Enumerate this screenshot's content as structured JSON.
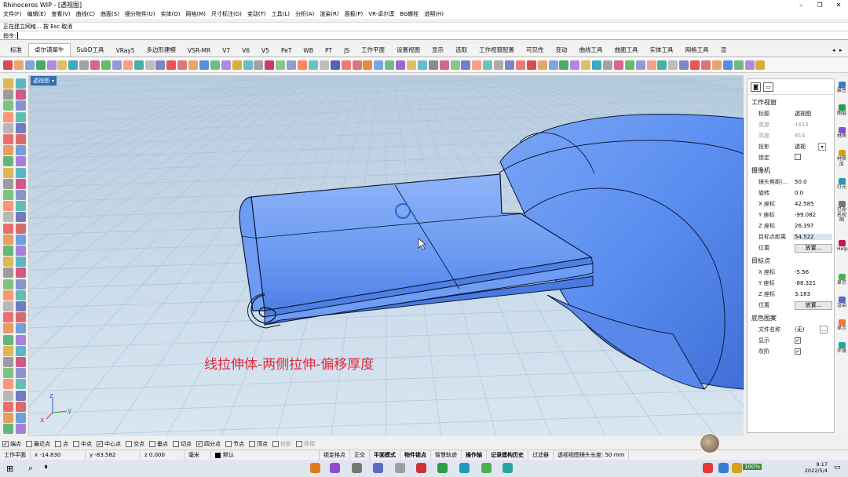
{
  "window": {
    "title": "Rhinoceros WIP - [透视图]",
    "controls": [
      "–",
      "❐",
      "✕"
    ]
  },
  "menu": [
    "文件(F)",
    "编辑(E)",
    "查看(V)",
    "曲线(C)",
    "曲面(S)",
    "细分物件(U)",
    "实体(O)",
    "网格(M)",
    "尺寸标注(D)",
    "变动(T)",
    "工具(L)",
    "分析(A)",
    "渲染(R)",
    "面板(P)",
    "VR-卓尔谟",
    "BG螺栓",
    "说明(H)"
  ],
  "command": {
    "history": "正在建立网格... 按 Esc 取消",
    "prompt": "指令:"
  },
  "tabs": [
    "标准",
    "卓尔谟犀牛",
    "SubD工具",
    "VRay5",
    "多边形建模",
    "VSR-MR",
    "V7",
    "V6",
    "V5",
    "PeT",
    "WB",
    "PT",
    "JS",
    "工作平面",
    "设置视图",
    "显示",
    "选取",
    "工作视窗配置",
    "可见性",
    "变动",
    "曲线工具",
    "曲面工具",
    "实体工具",
    "网格工具",
    "渲"
  ],
  "active_tab_index": 1,
  "viewport": {
    "label": "透视图",
    "caption": "线拉伸体-两侧拉伸-偏移厚度",
    "axes": {
      "x": "x",
      "y": "y",
      "z": "z"
    }
  },
  "properties": {
    "sections": [
      {
        "title": "工作视窗",
        "rows": [
          {
            "key": "标题",
            "value": "透视图"
          },
          {
            "key": "宽度",
            "value": "1615",
            "dim": true
          },
          {
            "key": "高度",
            "value": "814",
            "dim": true
          },
          {
            "key": "投影",
            "value": "透视",
            "select": true
          },
          {
            "key": "锁定",
            "value": "",
            "check": false
          }
        ]
      },
      {
        "title": "摄像机",
        "rows": [
          {
            "key": "镜头焦距(...",
            "value": "50.0"
          },
          {
            "key": "旋转",
            "value": "0.0"
          },
          {
            "key": "X 座标",
            "value": "42.585"
          },
          {
            "key": "Y 座标",
            "value": "-99.082"
          },
          {
            "key": "Z 座标",
            "value": "26.397"
          },
          {
            "key": "目标点距离",
            "value": "54.522",
            "selected": true
          },
          {
            "key": "位置",
            "value": "放置...",
            "button": true
          }
        ]
      },
      {
        "title": "目标点",
        "rows": [
          {
            "key": "X 座标",
            "value": "-5.56"
          },
          {
            "key": "Y 座标",
            "value": "-88.321"
          },
          {
            "key": "Z 座标",
            "value": "3.183"
          },
          {
            "key": "位置",
            "value": "放置...",
            "button": true
          }
        ]
      },
      {
        "title": "底色图案",
        "rows": [
          {
            "key": "文件名称",
            "value": "(无)",
            "more": true
          },
          {
            "key": "显示",
            "value": "",
            "check": true
          },
          {
            "key": "灰阶",
            "value": "",
            "check": true
          }
        ]
      }
    ]
  },
  "side_tabs": [
    "属性",
    "图层",
    "材质",
    "材质库",
    "灯光",
    "已命名视图",
    "Help",
    "显示",
    "渲染",
    "显示",
    "环境"
  ],
  "osnaps": [
    {
      "label": "端点",
      "checked": true
    },
    {
      "label": "最近点",
      "checked": false
    },
    {
      "label": "点",
      "checked": false
    },
    {
      "label": "中点",
      "checked": false
    },
    {
      "label": "中心点",
      "checked": true
    },
    {
      "label": "交点",
      "checked": false
    },
    {
      "label": "垂点",
      "checked": false
    },
    {
      "label": "切点",
      "checked": false
    },
    {
      "label": "四分点",
      "checked": true
    },
    {
      "label": "节点",
      "checked": false
    },
    {
      "label": "顶点",
      "checked": false
    },
    {
      "label": "投影",
      "checked": false,
      "dim": true
    },
    {
      "label": "停用",
      "checked": false,
      "dim": true
    }
  ],
  "status": {
    "cplane": "工作平面",
    "x": "x -14.830",
    "y": "y -83.582",
    "z": "z 0.000",
    "unit": "毫米",
    "layer": "默认",
    "toggles": [
      "锁定格点",
      "正交",
      "平面模式",
      "物件锁点",
      "智慧轨迹",
      "操作轴",
      "记录建构历史",
      "过滤器"
    ],
    "bold_toggles": [
      "平面模式",
      "物件锁点",
      "操作轴",
      "记录建构历史"
    ],
    "message": "透视视图镜头长度: 50 mm"
  },
  "taskbar": {
    "battery": "100%",
    "time": "9:17",
    "date": "2022/5/4"
  }
}
